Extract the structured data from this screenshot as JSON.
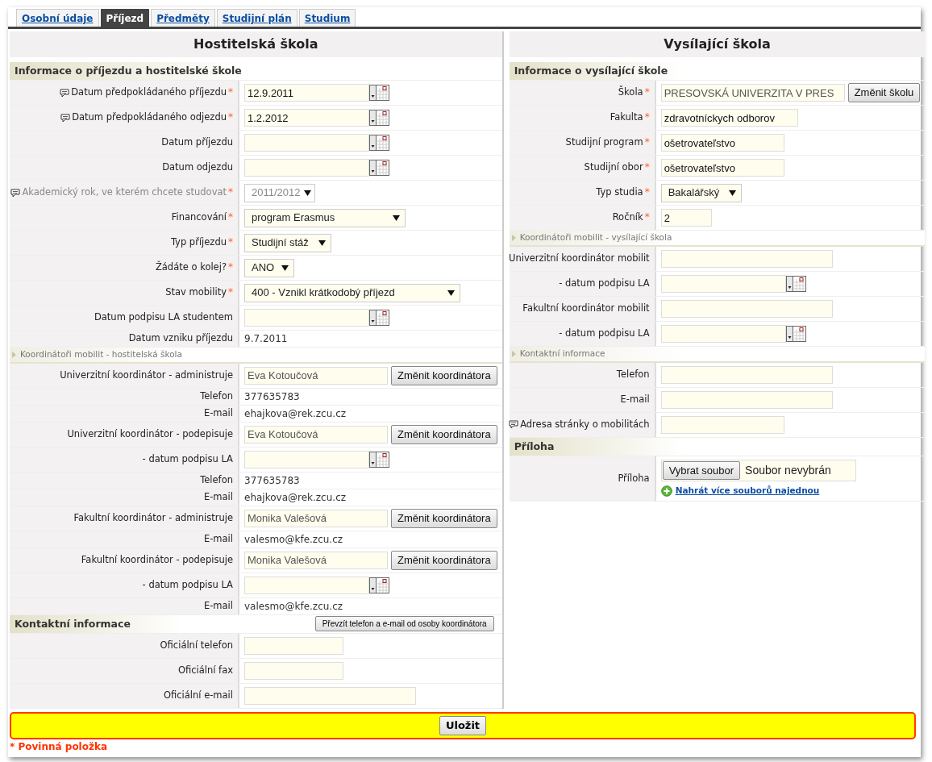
{
  "required_mark": "*",
  "tabs": [
    {
      "label": "Osobní údaje",
      "selected": false
    },
    {
      "label": "Příjezd",
      "selected": true
    },
    {
      "label": "Předměty",
      "selected": false
    },
    {
      "label": "Studijní plán",
      "selected": false
    },
    {
      "label": "Studium",
      "selected": false
    }
  ],
  "columns": [
    {
      "title": "Hostitelská škola",
      "rows": [
        {
          "kind": "section",
          "label": "Informace o příjezdu a hostitelské škole"
        },
        {
          "kind": "date",
          "label": "Datum předpokládaného příjezdu",
          "required": true,
          "info": true,
          "value": "12.9.2011"
        },
        {
          "kind": "date",
          "label": "Datum předpokládaného odjezdu",
          "required": true,
          "info": true,
          "value": "1.2.2012"
        },
        {
          "kind": "date",
          "label": "Datum příjezdu",
          "required": false,
          "info": false
        },
        {
          "kind": "date",
          "label": "Datum odjezdu",
          "required": false,
          "info": false
        },
        {
          "kind": "select",
          "label": "Akademický rok, ve kterém chcete studovat",
          "required": true,
          "info": true,
          "disabled": true,
          "value": "2011/2012"
        },
        {
          "kind": "select",
          "label": "Financování",
          "required": true,
          "info": false,
          "disabled": false,
          "value": "program Erasmus"
        },
        {
          "kind": "select",
          "label": "Typ příjezdu",
          "required": true,
          "info": false,
          "disabled": false,
          "value": "Studijní stáž"
        },
        {
          "kind": "select",
          "label": "Žádáte o kolej?",
          "required": true,
          "info": false,
          "disabled": false,
          "value": "ANO"
        },
        {
          "kind": "select",
          "label": "Stav mobility",
          "required": true,
          "info": false,
          "disabled": false,
          "value": "400 - Vznikl krátkodobý příjezd"
        },
        {
          "kind": "date",
          "label": "Datum podpisu LA studentem",
          "required": false,
          "info": false
        },
        {
          "kind": "readonly",
          "label": "Datum vzniku příjezdu",
          "value": "9.7.2011"
        },
        {
          "kind": "subsection",
          "label": "Koordinátoři mobilit - hostitelská škola"
        },
        {
          "kind": "picker",
          "label": "Univerzitní koordinátor - administruje",
          "required": false,
          "info": false,
          "value": "Eva Kotoučová",
          "button": "Změnit koordinátora"
        },
        {
          "kind": "readonly",
          "label": "Telefon",
          "value": "377635783"
        },
        {
          "kind": "readonly",
          "label": "E-mail",
          "value": "ehajkova@rek.zcu.cz"
        },
        {
          "kind": "picker",
          "label": "Univerzitní koordinátor - podepisuje",
          "required": false,
          "info": false,
          "value": "Eva Kotoučová",
          "button": "Změnit koordinátora"
        },
        {
          "kind": "date",
          "label": "- datum podpisu LA",
          "required": false,
          "info": false
        },
        {
          "kind": "readonly",
          "label": "Telefon",
          "value": "377635783"
        },
        {
          "kind": "readonly",
          "label": "E-mail",
          "value": "ehajkova@rek.zcu.cz"
        },
        {
          "kind": "picker",
          "label": "Fakultní koordinátor - administruje",
          "required": false,
          "info": false,
          "value": "Monika Valešová",
          "button": "Změnit koordinátora"
        },
        {
          "kind": "readonly",
          "label": "E-mail",
          "value": "valesmo@kfe.zcu.cz"
        },
        {
          "kind": "picker",
          "label": "Fakultní koordinátor - podepisuje",
          "required": false,
          "info": false,
          "value": "Monika Valešová",
          "button": "Změnit koordinátora"
        },
        {
          "kind": "date",
          "label": "- datum podpisu LA",
          "required": false,
          "info": false
        },
        {
          "kind": "readonly",
          "label": "E-mail",
          "value": "valesmo@kfe.zcu.cz"
        },
        {
          "kind": "section",
          "label": "Kontaktní informace",
          "button": "Převzít telefon a e-mail od osoby koordinátora"
        },
        {
          "kind": "text",
          "label": "Oficiální telefon",
          "required": false,
          "info": false
        },
        {
          "kind": "text",
          "label": "Oficiální fax",
          "required": false,
          "info": false
        },
        {
          "kind": "text",
          "label": "Oficiální e-mail",
          "required": false,
          "info": false
        }
      ]
    },
    {
      "title": "Vysílající škola",
      "rows": [
        {
          "kind": "section",
          "label": "Informace o vysílající škole"
        },
        {
          "kind": "picker",
          "label": "Škola",
          "required": true,
          "info": false,
          "value": "PRESOVSKÁ UNIVERZITA V PRES",
          "button": "Změnit školu"
        },
        {
          "kind": "text",
          "label": "Fakulta",
          "required": true,
          "info": false,
          "value": "zdravotníckych odborov"
        },
        {
          "kind": "text",
          "label": "Studijní program",
          "required": true,
          "info": false,
          "value": "ošetrovateľstvo"
        },
        {
          "kind": "text",
          "label": "Studijní obor",
          "required": true,
          "info": false,
          "value": "ošetrovateľstvo"
        },
        {
          "kind": "select",
          "label": "Typ studia",
          "required": true,
          "info": false,
          "disabled": false,
          "value": "Bakalářský"
        },
        {
          "kind": "text",
          "label": "Ročník",
          "required": true,
          "info": false,
          "value": "2"
        },
        {
          "kind": "subsection",
          "label": "Koordinátoři mobilit - vysílající škola"
        },
        {
          "kind": "text",
          "label": "Univerzitní koordinátor mobilit",
          "required": false,
          "info": false
        },
        {
          "kind": "date",
          "label": "- datum podpisu LA",
          "required": false,
          "info": false
        },
        {
          "kind": "text",
          "label": "Fakultní koordinátor mobilit",
          "required": false,
          "info": false
        },
        {
          "kind": "date",
          "label": "- datum podpisu LA",
          "required": false,
          "info": false
        },
        {
          "kind": "subsection",
          "label": "Kontaktní informace"
        },
        {
          "kind": "text",
          "label": "Telefon",
          "required": false,
          "info": false
        },
        {
          "kind": "text",
          "label": "E-mail",
          "required": false,
          "info": false
        },
        {
          "kind": "text",
          "label": "Adresa stránky o mobilitách",
          "required": false,
          "info": true
        },
        {
          "kind": "section",
          "label": "Příloha"
        },
        {
          "kind": "file",
          "label": "Příloha",
          "button": "Vybrat soubor",
          "status": "Soubor nevybrán",
          "link": "Nahrát více souborů najednou"
        }
      ]
    }
  ],
  "save_button": "Uložit",
  "required_note": "* Povinná položka"
}
